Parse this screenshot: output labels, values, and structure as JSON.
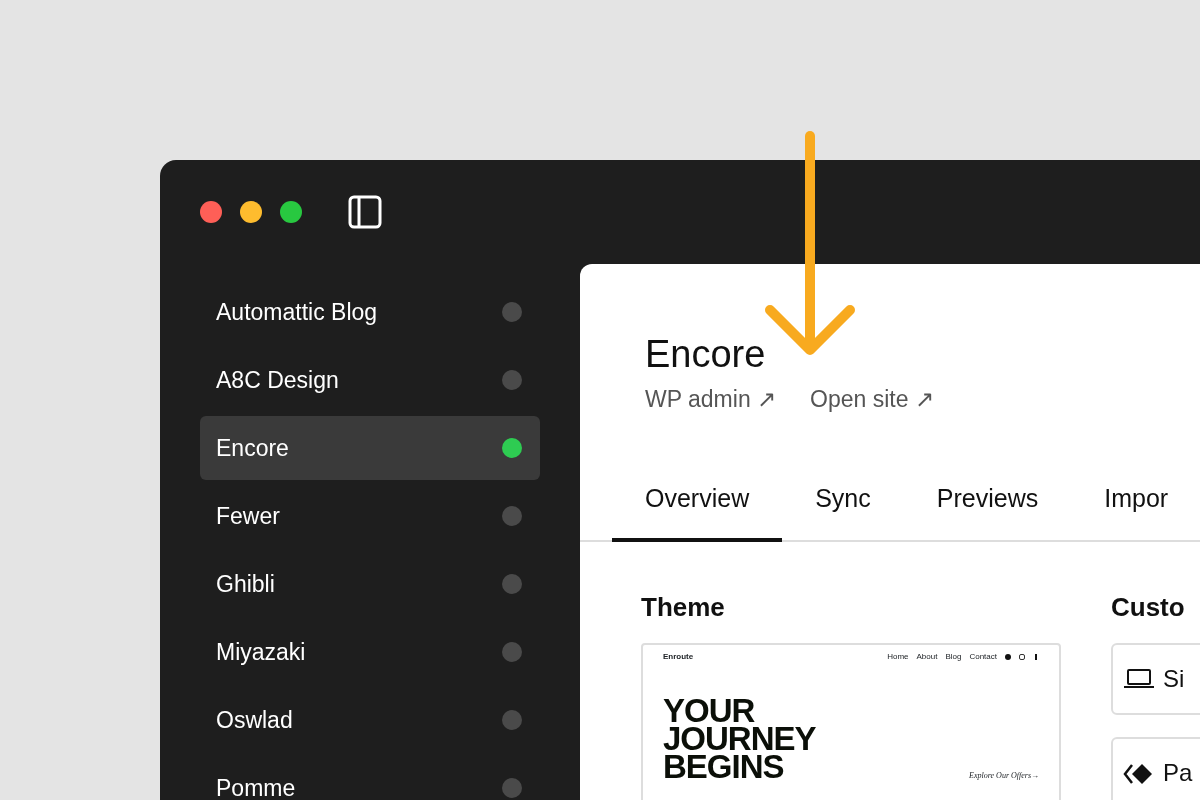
{
  "sites": [
    {
      "name": "Automattic Blog",
      "selected": false,
      "running": false
    },
    {
      "name": "A8C Design",
      "selected": false,
      "running": false
    },
    {
      "name": "Encore",
      "selected": true,
      "running": true
    },
    {
      "name": "Fewer",
      "selected": false,
      "running": false
    },
    {
      "name": "Ghibli",
      "selected": false,
      "running": false
    },
    {
      "name": "Miyazaki",
      "selected": false,
      "running": false
    },
    {
      "name": "Oswlad",
      "selected": false,
      "running": false
    },
    {
      "name": "Pomme",
      "selected": false,
      "running": false
    }
  ],
  "site": {
    "title": "Encore",
    "links": [
      "WP admin ↗",
      "Open site ↗"
    ]
  },
  "tabs": [
    {
      "label": "Overview",
      "selected": true
    },
    {
      "label": "Sync",
      "selected": false
    },
    {
      "label": "Previews",
      "selected": false
    },
    {
      "label": "Impor",
      "selected": false
    }
  ],
  "theme": {
    "heading": "Theme",
    "preview": {
      "logo": "Enroute",
      "nav": [
        "Home",
        "About",
        "Blog",
        "Contact"
      ],
      "headline": "YOUR JOURNEY BEGINS",
      "link": "Explore Our Offers→"
    }
  },
  "customize": {
    "heading": "Custo",
    "buttons": [
      {
        "label": "Si",
        "kind": "laptop"
      },
      {
        "label": "Pa",
        "kind": "diamond"
      }
    ]
  }
}
